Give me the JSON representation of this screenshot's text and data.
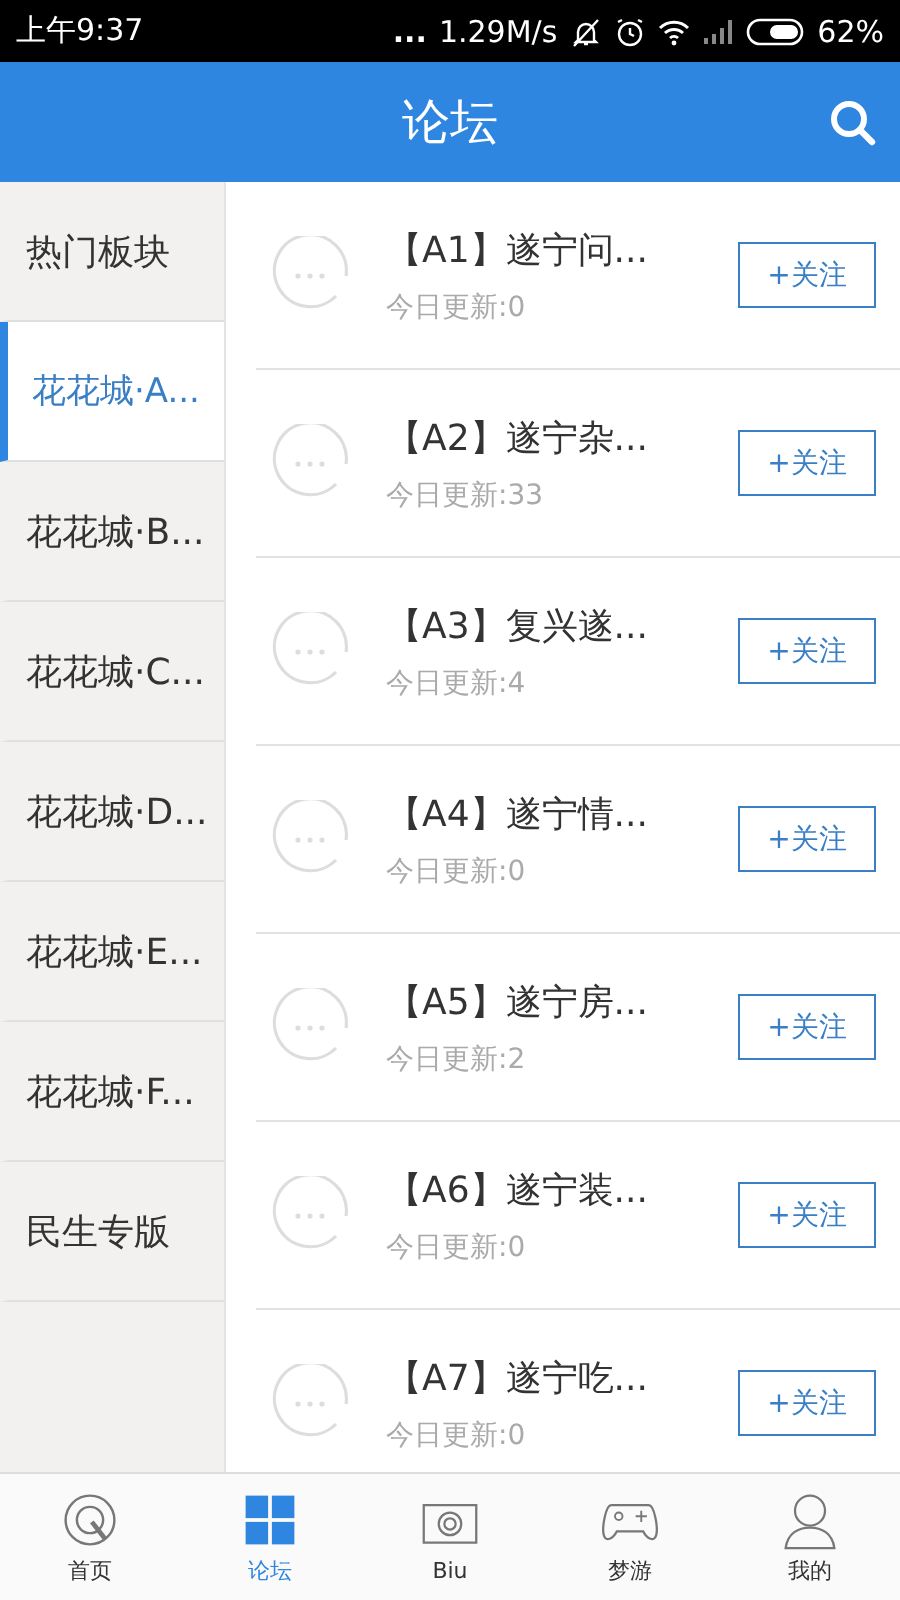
{
  "status_bar": {
    "time": "上午9:37",
    "dots": "...",
    "speed": "1.29M/s",
    "battery": "62%"
  },
  "header": {
    "title": "论坛"
  },
  "sidebar": {
    "items": [
      {
        "label": "热门板块",
        "selected": false
      },
      {
        "label": "花花城·A...",
        "selected": true
      },
      {
        "label": "花花城·B...",
        "selected": false
      },
      {
        "label": "花花城·C...",
        "selected": false
      },
      {
        "label": "花花城·D...",
        "selected": false
      },
      {
        "label": "花花城·E...",
        "selected": false
      },
      {
        "label": "花花城·F...",
        "selected": false
      },
      {
        "label": "民生专版",
        "selected": false
      }
    ]
  },
  "forums": [
    {
      "title": "【A1】遂宁问...",
      "updates": "今日更新:0",
      "button": "+关注"
    },
    {
      "title": "【A2】遂宁杂...",
      "updates": "今日更新:33",
      "button": "+关注"
    },
    {
      "title": "【A3】复兴遂...",
      "updates": "今日更新:4",
      "button": "+关注"
    },
    {
      "title": "【A4】遂宁情...",
      "updates": "今日更新:0",
      "button": "+关注"
    },
    {
      "title": "【A5】遂宁房...",
      "updates": "今日更新:2",
      "button": "+关注"
    },
    {
      "title": "【A6】遂宁装...",
      "updates": "今日更新:0",
      "button": "+关注"
    },
    {
      "title": "【A7】遂宁吃...",
      "updates": "今日更新:0",
      "button": "+关注"
    }
  ],
  "tab_bar": [
    {
      "kind": "home",
      "label": "首页",
      "selected": false
    },
    {
      "kind": "grid",
      "label": "论坛",
      "selected": true
    },
    {
      "kind": "camera",
      "label": "Biu",
      "selected": false
    },
    {
      "kind": "gamepad",
      "label": "梦游",
      "selected": false
    },
    {
      "kind": "person",
      "label": "我的",
      "selected": false
    }
  ]
}
